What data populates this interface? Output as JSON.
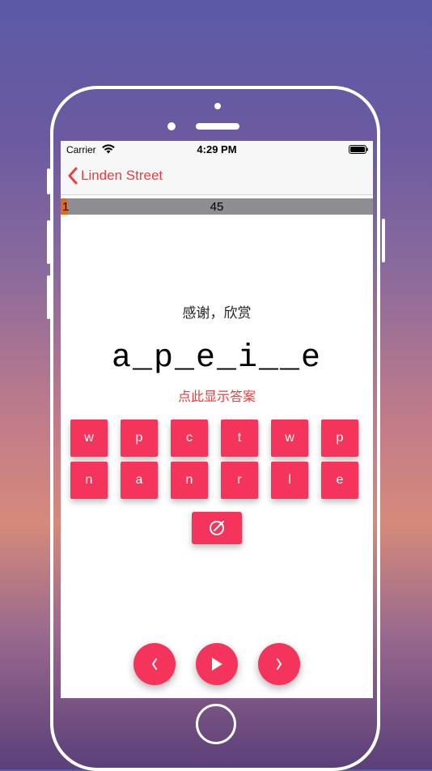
{
  "status_bar": {
    "carrier": "Carrier",
    "time": "4:29 PM"
  },
  "nav": {
    "back_label": "Linden Street"
  },
  "progress": {
    "current": "1",
    "total": "45",
    "fraction": 0.022
  },
  "quiz": {
    "meaning": "感谢，欣赏",
    "pattern": "a_p_e_i__e",
    "reveal_label": "点此显示答案"
  },
  "keyboard": {
    "keys": [
      "w",
      "p",
      "c",
      "t",
      "w",
      "p",
      "n",
      "a",
      "n",
      "r",
      "l",
      "e"
    ]
  },
  "icons": {
    "wifi": "wifi-icon",
    "battery": "battery-icon",
    "back": "chevron-left-icon",
    "clear": "clear-icon",
    "previous": "chevron-left-icon",
    "play": "play-icon",
    "next": "chevron-right-icon"
  },
  "colors": {
    "accent": "#f5345b",
    "back_tint": "#e8403c",
    "progress_fill": "#e06a1e",
    "progress_track": "#8e8e92"
  }
}
